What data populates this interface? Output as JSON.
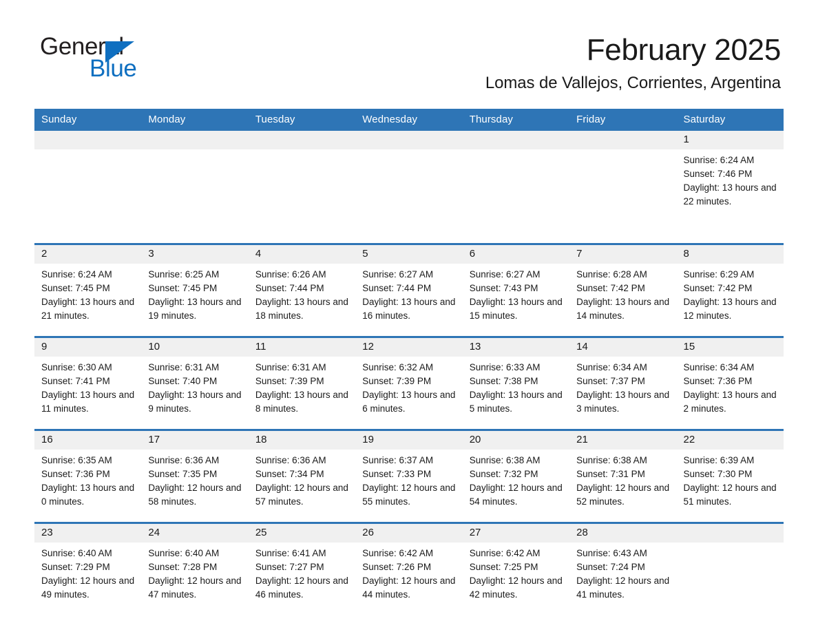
{
  "brand": {
    "name_part1": "General",
    "name_part2": "Blue",
    "triangle_color": "#0f6fc0"
  },
  "header": {
    "title": "February 2025",
    "location": "Lomas de Vallejos, Corrientes, Argentina"
  },
  "theme": {
    "header_blue": "#2e75b6",
    "cell_header_gray": "#f0f0f0",
    "text": "#1a1a1a"
  },
  "weekdays": [
    "Sunday",
    "Monday",
    "Tuesday",
    "Wednesday",
    "Thursday",
    "Friday",
    "Saturday"
  ],
  "labels": {
    "sunrise_prefix": "Sunrise:",
    "sunset_prefix": "Sunset:",
    "daylight_prefix": "Daylight:"
  },
  "weeks": [
    [
      {
        "day": "",
        "empty": true
      },
      {
        "day": "",
        "empty": true
      },
      {
        "day": "",
        "empty": true
      },
      {
        "day": "",
        "empty": true
      },
      {
        "day": "",
        "empty": true
      },
      {
        "day": "",
        "empty": true
      },
      {
        "day": "1",
        "sunrise": "Sunrise: 6:24 AM",
        "sunset": "Sunset: 7:46 PM",
        "daylight": "Daylight: 13 hours and 22 minutes."
      }
    ],
    [
      {
        "day": "2",
        "sunrise": "Sunrise: 6:24 AM",
        "sunset": "Sunset: 7:45 PM",
        "daylight": "Daylight: 13 hours and 21 minutes."
      },
      {
        "day": "3",
        "sunrise": "Sunrise: 6:25 AM",
        "sunset": "Sunset: 7:45 PM",
        "daylight": "Daylight: 13 hours and 19 minutes."
      },
      {
        "day": "4",
        "sunrise": "Sunrise: 6:26 AM",
        "sunset": "Sunset: 7:44 PM",
        "daylight": "Daylight: 13 hours and 18 minutes."
      },
      {
        "day": "5",
        "sunrise": "Sunrise: 6:27 AM",
        "sunset": "Sunset: 7:44 PM",
        "daylight": "Daylight: 13 hours and 16 minutes."
      },
      {
        "day": "6",
        "sunrise": "Sunrise: 6:27 AM",
        "sunset": "Sunset: 7:43 PM",
        "daylight": "Daylight: 13 hours and 15 minutes."
      },
      {
        "day": "7",
        "sunrise": "Sunrise: 6:28 AM",
        "sunset": "Sunset: 7:42 PM",
        "daylight": "Daylight: 13 hours and 14 minutes."
      },
      {
        "day": "8",
        "sunrise": "Sunrise: 6:29 AM",
        "sunset": "Sunset: 7:42 PM",
        "daylight": "Daylight: 13 hours and 12 minutes."
      }
    ],
    [
      {
        "day": "9",
        "sunrise": "Sunrise: 6:30 AM",
        "sunset": "Sunset: 7:41 PM",
        "daylight": "Daylight: 13 hours and 11 minutes."
      },
      {
        "day": "10",
        "sunrise": "Sunrise: 6:31 AM",
        "sunset": "Sunset: 7:40 PM",
        "daylight": "Daylight: 13 hours and 9 minutes."
      },
      {
        "day": "11",
        "sunrise": "Sunrise: 6:31 AM",
        "sunset": "Sunset: 7:39 PM",
        "daylight": "Daylight: 13 hours and 8 minutes."
      },
      {
        "day": "12",
        "sunrise": "Sunrise: 6:32 AM",
        "sunset": "Sunset: 7:39 PM",
        "daylight": "Daylight: 13 hours and 6 minutes."
      },
      {
        "day": "13",
        "sunrise": "Sunrise: 6:33 AM",
        "sunset": "Sunset: 7:38 PM",
        "daylight": "Daylight: 13 hours and 5 minutes."
      },
      {
        "day": "14",
        "sunrise": "Sunrise: 6:34 AM",
        "sunset": "Sunset: 7:37 PM",
        "daylight": "Daylight: 13 hours and 3 minutes."
      },
      {
        "day": "15",
        "sunrise": "Sunrise: 6:34 AM",
        "sunset": "Sunset: 7:36 PM",
        "daylight": "Daylight: 13 hours and 2 minutes."
      }
    ],
    [
      {
        "day": "16",
        "sunrise": "Sunrise: 6:35 AM",
        "sunset": "Sunset: 7:36 PM",
        "daylight": "Daylight: 13 hours and 0 minutes."
      },
      {
        "day": "17",
        "sunrise": "Sunrise: 6:36 AM",
        "sunset": "Sunset: 7:35 PM",
        "daylight": "Daylight: 12 hours and 58 minutes."
      },
      {
        "day": "18",
        "sunrise": "Sunrise: 6:36 AM",
        "sunset": "Sunset: 7:34 PM",
        "daylight": "Daylight: 12 hours and 57 minutes."
      },
      {
        "day": "19",
        "sunrise": "Sunrise: 6:37 AM",
        "sunset": "Sunset: 7:33 PM",
        "daylight": "Daylight: 12 hours and 55 minutes."
      },
      {
        "day": "20",
        "sunrise": "Sunrise: 6:38 AM",
        "sunset": "Sunset: 7:32 PM",
        "daylight": "Daylight: 12 hours and 54 minutes."
      },
      {
        "day": "21",
        "sunrise": "Sunrise: 6:38 AM",
        "sunset": "Sunset: 7:31 PM",
        "daylight": "Daylight: 12 hours and 52 minutes."
      },
      {
        "day": "22",
        "sunrise": "Sunrise: 6:39 AM",
        "sunset": "Sunset: 7:30 PM",
        "daylight": "Daylight: 12 hours and 51 minutes."
      }
    ],
    [
      {
        "day": "23",
        "sunrise": "Sunrise: 6:40 AM",
        "sunset": "Sunset: 7:29 PM",
        "daylight": "Daylight: 12 hours and 49 minutes."
      },
      {
        "day": "24",
        "sunrise": "Sunrise: 6:40 AM",
        "sunset": "Sunset: 7:28 PM",
        "daylight": "Daylight: 12 hours and 47 minutes."
      },
      {
        "day": "25",
        "sunrise": "Sunrise: 6:41 AM",
        "sunset": "Sunset: 7:27 PM",
        "daylight": "Daylight: 12 hours and 46 minutes."
      },
      {
        "day": "26",
        "sunrise": "Sunrise: 6:42 AM",
        "sunset": "Sunset: 7:26 PM",
        "daylight": "Daylight: 12 hours and 44 minutes."
      },
      {
        "day": "27",
        "sunrise": "Sunrise: 6:42 AM",
        "sunset": "Sunset: 7:25 PM",
        "daylight": "Daylight: 12 hours and 42 minutes."
      },
      {
        "day": "28",
        "sunrise": "Sunrise: 6:43 AM",
        "sunset": "Sunset: 7:24 PM",
        "daylight": "Daylight: 12 hours and 41 minutes."
      },
      {
        "day": "",
        "empty": true
      }
    ]
  ]
}
